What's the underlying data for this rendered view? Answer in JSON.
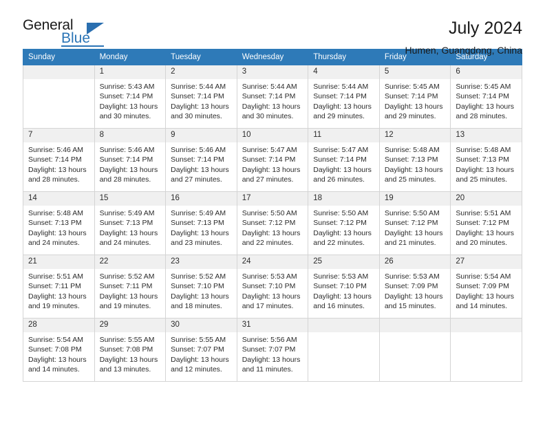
{
  "logo": {
    "word1": "General",
    "word2": "Blue",
    "triangle_color": "#2a6fb0"
  },
  "header": {
    "title": "July 2024",
    "location": "Humen, Guangdong, China",
    "accent_color": "#2e7ab8"
  },
  "weekdays": [
    "Sunday",
    "Monday",
    "Tuesday",
    "Wednesday",
    "Thursday",
    "Friday",
    "Saturday"
  ],
  "labels": {
    "sunrise_prefix": "Sunrise:",
    "sunset_prefix": "Sunset:",
    "daylight_prefix": "Daylight:"
  },
  "weeks": [
    [
      {
        "day": "",
        "empty": true
      },
      {
        "day": "1",
        "sunrise": "Sunrise: 5:43 AM",
        "sunset": "Sunset: 7:14 PM",
        "daylight": "Daylight: 13 hours and 30 minutes."
      },
      {
        "day": "2",
        "sunrise": "Sunrise: 5:44 AM",
        "sunset": "Sunset: 7:14 PM",
        "daylight": "Daylight: 13 hours and 30 minutes."
      },
      {
        "day": "3",
        "sunrise": "Sunrise: 5:44 AM",
        "sunset": "Sunset: 7:14 PM",
        "daylight": "Daylight: 13 hours and 30 minutes."
      },
      {
        "day": "4",
        "sunrise": "Sunrise: 5:44 AM",
        "sunset": "Sunset: 7:14 PM",
        "daylight": "Daylight: 13 hours and 29 minutes."
      },
      {
        "day": "5",
        "sunrise": "Sunrise: 5:45 AM",
        "sunset": "Sunset: 7:14 PM",
        "daylight": "Daylight: 13 hours and 29 minutes."
      },
      {
        "day": "6",
        "sunrise": "Sunrise: 5:45 AM",
        "sunset": "Sunset: 7:14 PM",
        "daylight": "Daylight: 13 hours and 28 minutes."
      }
    ],
    [
      {
        "day": "7",
        "sunrise": "Sunrise: 5:46 AM",
        "sunset": "Sunset: 7:14 PM",
        "daylight": "Daylight: 13 hours and 28 minutes."
      },
      {
        "day": "8",
        "sunrise": "Sunrise: 5:46 AM",
        "sunset": "Sunset: 7:14 PM",
        "daylight": "Daylight: 13 hours and 28 minutes."
      },
      {
        "day": "9",
        "sunrise": "Sunrise: 5:46 AM",
        "sunset": "Sunset: 7:14 PM",
        "daylight": "Daylight: 13 hours and 27 minutes."
      },
      {
        "day": "10",
        "sunrise": "Sunrise: 5:47 AM",
        "sunset": "Sunset: 7:14 PM",
        "daylight": "Daylight: 13 hours and 27 minutes."
      },
      {
        "day": "11",
        "sunrise": "Sunrise: 5:47 AM",
        "sunset": "Sunset: 7:14 PM",
        "daylight": "Daylight: 13 hours and 26 minutes."
      },
      {
        "day": "12",
        "sunrise": "Sunrise: 5:48 AM",
        "sunset": "Sunset: 7:13 PM",
        "daylight": "Daylight: 13 hours and 25 minutes."
      },
      {
        "day": "13",
        "sunrise": "Sunrise: 5:48 AM",
        "sunset": "Sunset: 7:13 PM",
        "daylight": "Daylight: 13 hours and 25 minutes."
      }
    ],
    [
      {
        "day": "14",
        "sunrise": "Sunrise: 5:48 AM",
        "sunset": "Sunset: 7:13 PM",
        "daylight": "Daylight: 13 hours and 24 minutes."
      },
      {
        "day": "15",
        "sunrise": "Sunrise: 5:49 AM",
        "sunset": "Sunset: 7:13 PM",
        "daylight": "Daylight: 13 hours and 24 minutes."
      },
      {
        "day": "16",
        "sunrise": "Sunrise: 5:49 AM",
        "sunset": "Sunset: 7:13 PM",
        "daylight": "Daylight: 13 hours and 23 minutes."
      },
      {
        "day": "17",
        "sunrise": "Sunrise: 5:50 AM",
        "sunset": "Sunset: 7:12 PM",
        "daylight": "Daylight: 13 hours and 22 minutes."
      },
      {
        "day": "18",
        "sunrise": "Sunrise: 5:50 AM",
        "sunset": "Sunset: 7:12 PM",
        "daylight": "Daylight: 13 hours and 22 minutes."
      },
      {
        "day": "19",
        "sunrise": "Sunrise: 5:50 AM",
        "sunset": "Sunset: 7:12 PM",
        "daylight": "Daylight: 13 hours and 21 minutes."
      },
      {
        "day": "20",
        "sunrise": "Sunrise: 5:51 AM",
        "sunset": "Sunset: 7:12 PM",
        "daylight": "Daylight: 13 hours and 20 minutes."
      }
    ],
    [
      {
        "day": "21",
        "sunrise": "Sunrise: 5:51 AM",
        "sunset": "Sunset: 7:11 PM",
        "daylight": "Daylight: 13 hours and 19 minutes."
      },
      {
        "day": "22",
        "sunrise": "Sunrise: 5:52 AM",
        "sunset": "Sunset: 7:11 PM",
        "daylight": "Daylight: 13 hours and 19 minutes."
      },
      {
        "day": "23",
        "sunrise": "Sunrise: 5:52 AM",
        "sunset": "Sunset: 7:10 PM",
        "daylight": "Daylight: 13 hours and 18 minutes."
      },
      {
        "day": "24",
        "sunrise": "Sunrise: 5:53 AM",
        "sunset": "Sunset: 7:10 PM",
        "daylight": "Daylight: 13 hours and 17 minutes."
      },
      {
        "day": "25",
        "sunrise": "Sunrise: 5:53 AM",
        "sunset": "Sunset: 7:10 PM",
        "daylight": "Daylight: 13 hours and 16 minutes."
      },
      {
        "day": "26",
        "sunrise": "Sunrise: 5:53 AM",
        "sunset": "Sunset: 7:09 PM",
        "daylight": "Daylight: 13 hours and 15 minutes."
      },
      {
        "day": "27",
        "sunrise": "Sunrise: 5:54 AM",
        "sunset": "Sunset: 7:09 PM",
        "daylight": "Daylight: 13 hours and 14 minutes."
      }
    ],
    [
      {
        "day": "28",
        "sunrise": "Sunrise: 5:54 AM",
        "sunset": "Sunset: 7:08 PM",
        "daylight": "Daylight: 13 hours and 14 minutes."
      },
      {
        "day": "29",
        "sunrise": "Sunrise: 5:55 AM",
        "sunset": "Sunset: 7:08 PM",
        "daylight": "Daylight: 13 hours and 13 minutes."
      },
      {
        "day": "30",
        "sunrise": "Sunrise: 5:55 AM",
        "sunset": "Sunset: 7:07 PM",
        "daylight": "Daylight: 13 hours and 12 minutes."
      },
      {
        "day": "31",
        "sunrise": "Sunrise: 5:56 AM",
        "sunset": "Sunset: 7:07 PM",
        "daylight": "Daylight: 13 hours and 11 minutes."
      },
      {
        "day": "",
        "empty": true
      },
      {
        "day": "",
        "empty": true
      },
      {
        "day": "",
        "empty": true
      }
    ]
  ]
}
